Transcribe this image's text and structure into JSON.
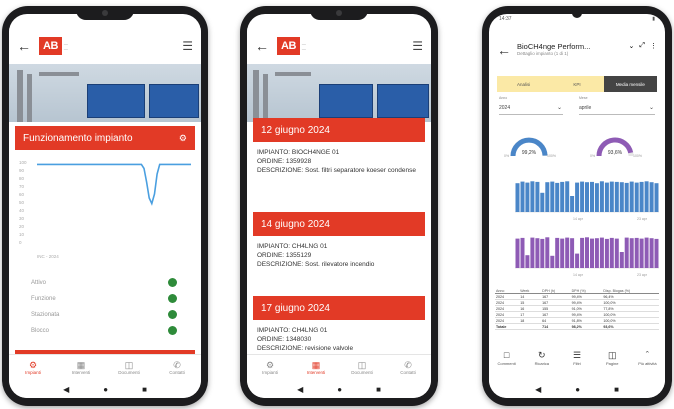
{
  "phone1": {
    "logo": "AB",
    "section_title": "Funzionamento impianto",
    "chart_data": {
      "type": "line",
      "y_ticks": [
        "100",
        "90",
        "80",
        "70",
        "60",
        "50",
        "40",
        "30",
        "20",
        "10",
        "0"
      ],
      "x_range_label": "INC - 2024",
      "values": [
        97,
        97,
        97,
        97,
        97,
        97,
        97,
        97,
        97,
        97,
        97,
        97,
        97,
        97,
        97,
        97,
        97,
        97,
        97,
        97,
        97,
        97,
        97,
        97,
        97,
        97,
        97,
        97,
        97,
        97,
        97,
        97,
        97,
        97,
        97,
        97,
        97,
        97,
        97,
        97,
        97,
        92,
        75,
        55,
        48,
        60,
        85,
        97,
        97,
        97,
        97,
        97,
        97,
        97,
        97,
        97,
        97,
        97,
        97,
        97
      ],
      "ylim": [
        0,
        100
      ]
    },
    "status_rows": [
      "Attivo",
      "Funzione",
      "Stazionata",
      "Blocco"
    ],
    "tabs": [
      "Impianti",
      "Interventi",
      "Documenti",
      "Contatti"
    ]
  },
  "phone2": {
    "logo": "AB",
    "cards": [
      {
        "date": "12 giugno 2024",
        "impianto": "IMPIANTO: BIOCH4NGE 01",
        "ordine": "ORDINE: 1359928",
        "descrizione": "DESCRIZIONE: Sost. filtri separatore koeser condense"
      },
      {
        "date": "14 giugno 2024",
        "impianto": "IMPIANTO: CH4LNG 01",
        "ordine": "ORDINE: 1355129",
        "descrizione": "DESCRIZIONE: Sost. rilevatore incendio"
      },
      {
        "date": "17 giugno 2024",
        "impianto": "IMPIANTO: CH4LNG 01",
        "ordine": "ORDINE: 1348030",
        "descrizione": "DESCRIZIONE: revisione valvole"
      }
    ],
    "tabs": [
      "Impianti",
      "Interventi",
      "Documenti",
      "Contatti"
    ]
  },
  "phone3": {
    "status_time": "14:37",
    "title": "BioCH4nge Perform...",
    "subtitle": "Dettaglio impianto (1 di 1)",
    "segments": [
      "Analisi",
      "KPI",
      "Media mensile"
    ],
    "year_label": "Anno",
    "year_value": "2024",
    "month_label": "Mese",
    "month_value": "aprile",
    "gauges": [
      {
        "value": "99,2%",
        "min": "0%",
        "max": "100%",
        "color": "#4a86c8",
        "fill": 0.992
      },
      {
        "value": "93,6%",
        "min": "0%",
        "max": "100%",
        "color": "#8e5bb5",
        "fill": 0.936
      }
    ],
    "bar_chart_1": {
      "color": "#4a86c8",
      "x_labels": [
        "14 apr",
        "23 apr"
      ],
      "values": [
        90,
        95,
        92,
        96,
        94,
        60,
        93,
        95,
        91,
        94,
        96,
        50,
        92,
        95,
        93,
        94,
        90,
        96,
        92,
        95,
        94,
        93,
        91,
        95,
        92,
        94,
        96,
        93,
        90
      ]
    },
    "bar_chart_2": {
      "color": "#8e5bb5",
      "x_labels": [
        "14 apr",
        "23 apr"
      ],
      "values": [
        92,
        94,
        40,
        95,
        93,
        91,
        96,
        38,
        94,
        92,
        95,
        93,
        45,
        94,
        96,
        92,
        93,
        95,
        91,
        94,
        92,
        50,
        95,
        93,
        94,
        92,
        95,
        93,
        91
      ]
    },
    "table": {
      "headers": [
        "Anno",
        "Week",
        "DPH (h)",
        "DPH (%)",
        "Disp. Biogas (%)"
      ],
      "rows": [
        [
          "2024",
          "14",
          "167",
          "99,4%",
          "96,4%"
        ],
        [
          "2024",
          "15",
          "167",
          "99,4%",
          "100,0%"
        ],
        [
          "2024",
          "16",
          "155",
          "91,0%",
          "77,8%"
        ],
        [
          "2024",
          "17",
          "167",
          "99,4%",
          "100,0%"
        ],
        [
          "2024",
          "18",
          "64",
          "91,8%",
          "100,0%"
        ]
      ],
      "total": [
        "Totale",
        "",
        "714",
        "98,2%",
        "93,6%"
      ]
    },
    "actions": [
      "Commenti",
      "Ricarica",
      "Filtri",
      "Pagine",
      "Più attività"
    ]
  }
}
